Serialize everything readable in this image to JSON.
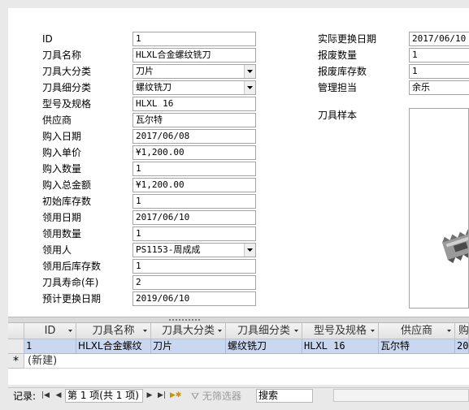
{
  "form": {
    "left_fields": [
      {
        "label": "ID",
        "value": "1"
      },
      {
        "label": "刀具名称",
        "value": "HLXL合金螺纹铣刀"
      },
      {
        "label": "刀具大分类",
        "value": "刀片",
        "dropdown": true
      },
      {
        "label": "刀具细分类",
        "value": "螺纹铣刀",
        "dropdown": true
      },
      {
        "label": "型号及规格",
        "value": "HLXL 16"
      },
      {
        "label": "供应商",
        "value": "瓦尔特"
      },
      {
        "label": "购入日期",
        "value": "2017/06/08"
      },
      {
        "label": "购入单价",
        "value": "¥1,200.00"
      },
      {
        "label": "购入数量",
        "value": "1"
      },
      {
        "label": "购入总金额",
        "value": "¥1,200.00"
      },
      {
        "label": "初始库存数",
        "value": "1"
      },
      {
        "label": "领用日期",
        "value": "2017/06/10"
      },
      {
        "label": "领用数量",
        "value": "1"
      },
      {
        "label": "领用人",
        "value": "PS1153-周成成",
        "dropdown": true
      },
      {
        "label": "领用后库存数",
        "value": "1"
      },
      {
        "label": "刀具寿命(年)",
        "value": "2"
      },
      {
        "label": "预计更换日期",
        "value": "2019/06/10"
      }
    ],
    "right_fields": [
      {
        "label": "实际更换日期",
        "value": "2017/06/10"
      },
      {
        "label": "报废数量",
        "value": "1"
      },
      {
        "label": "报废库存数",
        "value": "1"
      },
      {
        "label": "管理担当",
        "value": "余乐"
      }
    ],
    "image_label": "刀具样本"
  },
  "datasheet": {
    "columns": [
      "ID",
      "刀具名称",
      "刀具大分类",
      "刀具细分类",
      "型号及规格",
      "供应商",
      "购"
    ],
    "row": [
      "1",
      "HLXL合金螺纹",
      "刀片",
      "螺纹铣刀",
      "HLXL 16",
      "瓦尔特",
      "20"
    ],
    "new_row_marker": "*",
    "new_row_label": "(新建)"
  },
  "status": {
    "record_label": "记录:",
    "record_text": "第 1 项(共 1 项)",
    "filter_text": "无筛选器",
    "search_text": "搜索"
  },
  "icons": [
    "first-record-icon",
    "prev-record-icon",
    "next-record-icon",
    "last-record-icon",
    "new-record-icon",
    "filter-icon",
    "dropdown-arrow-icon"
  ]
}
